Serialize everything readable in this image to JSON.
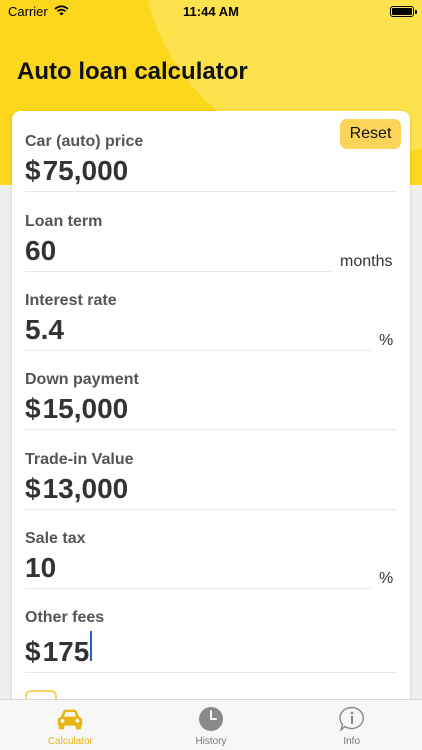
{
  "status_bar": {
    "carrier": "Carrier",
    "time": "11:44 AM",
    "battery_percent": 100
  },
  "header": {
    "title": "Auto loan calculator"
  },
  "toolbar": {
    "reset_label": "Reset"
  },
  "fields": {
    "car_price": {
      "label": "Car (auto) price",
      "currency": "$",
      "value": "75,000"
    },
    "loan_term": {
      "label": "Loan term",
      "value": "60",
      "unit": "months"
    },
    "interest_rate": {
      "label": "Interest rate",
      "value": "5.4",
      "unit": "%"
    },
    "down_payment": {
      "label": "Down payment",
      "currency": "$",
      "value": "15,000"
    },
    "trade_in": {
      "label": "Trade-in Value",
      "currency": "$",
      "value": "13,000"
    },
    "sale_tax": {
      "label": "Sale tax",
      "value": "10",
      "unit": "%"
    },
    "other_fees": {
      "label": "Other fees",
      "currency": "$",
      "value": "175"
    }
  },
  "tabs": [
    {
      "label": "Calculator",
      "icon": "car-icon",
      "active": true
    },
    {
      "label": "History",
      "icon": "clock-icon",
      "active": false
    },
    {
      "label": "Info",
      "icon": "info-icon",
      "active": false
    }
  ],
  "colors": {
    "accent": "#fcd71c",
    "button": "#fcd45a",
    "active_tab": "#e7b617",
    "cursor": "#2b5bd7"
  }
}
